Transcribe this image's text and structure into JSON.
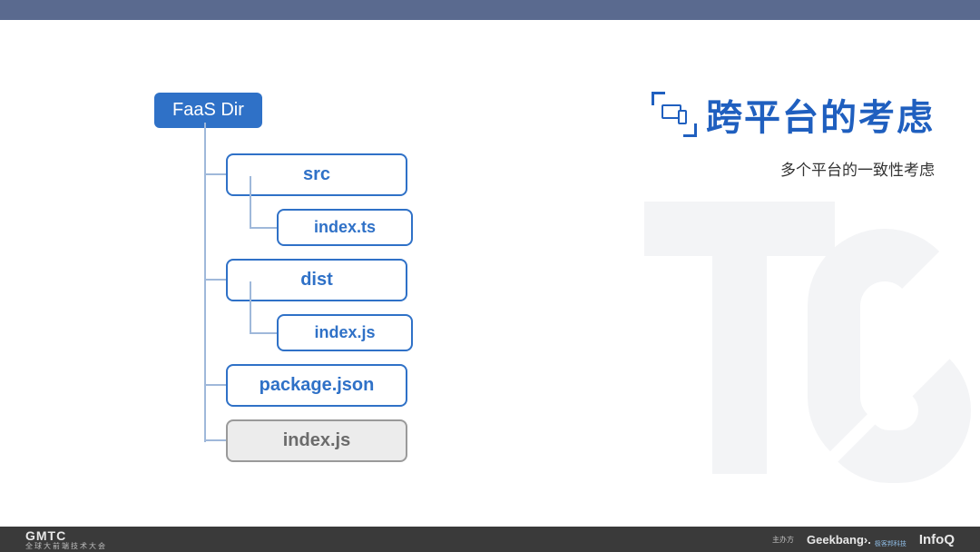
{
  "header": {
    "title": "跨平台的考虑",
    "subtitle": "多个平台的一致性考虑"
  },
  "tree": {
    "root": "FaaS Dir",
    "nodes": {
      "src": "src",
      "src_child": "index.ts",
      "dist": "dist",
      "dist_child": "index.js",
      "pkg": "package.json",
      "root_index": "index.js"
    }
  },
  "footer": {
    "left_brand": "GMTC",
    "left_sub": "全球大前端技术大会",
    "host_label": "主办方",
    "sponsor1": "Geekbang›.",
    "sponsor1_sub": "极客邦科技",
    "sponsor2": "InfoQ"
  }
}
